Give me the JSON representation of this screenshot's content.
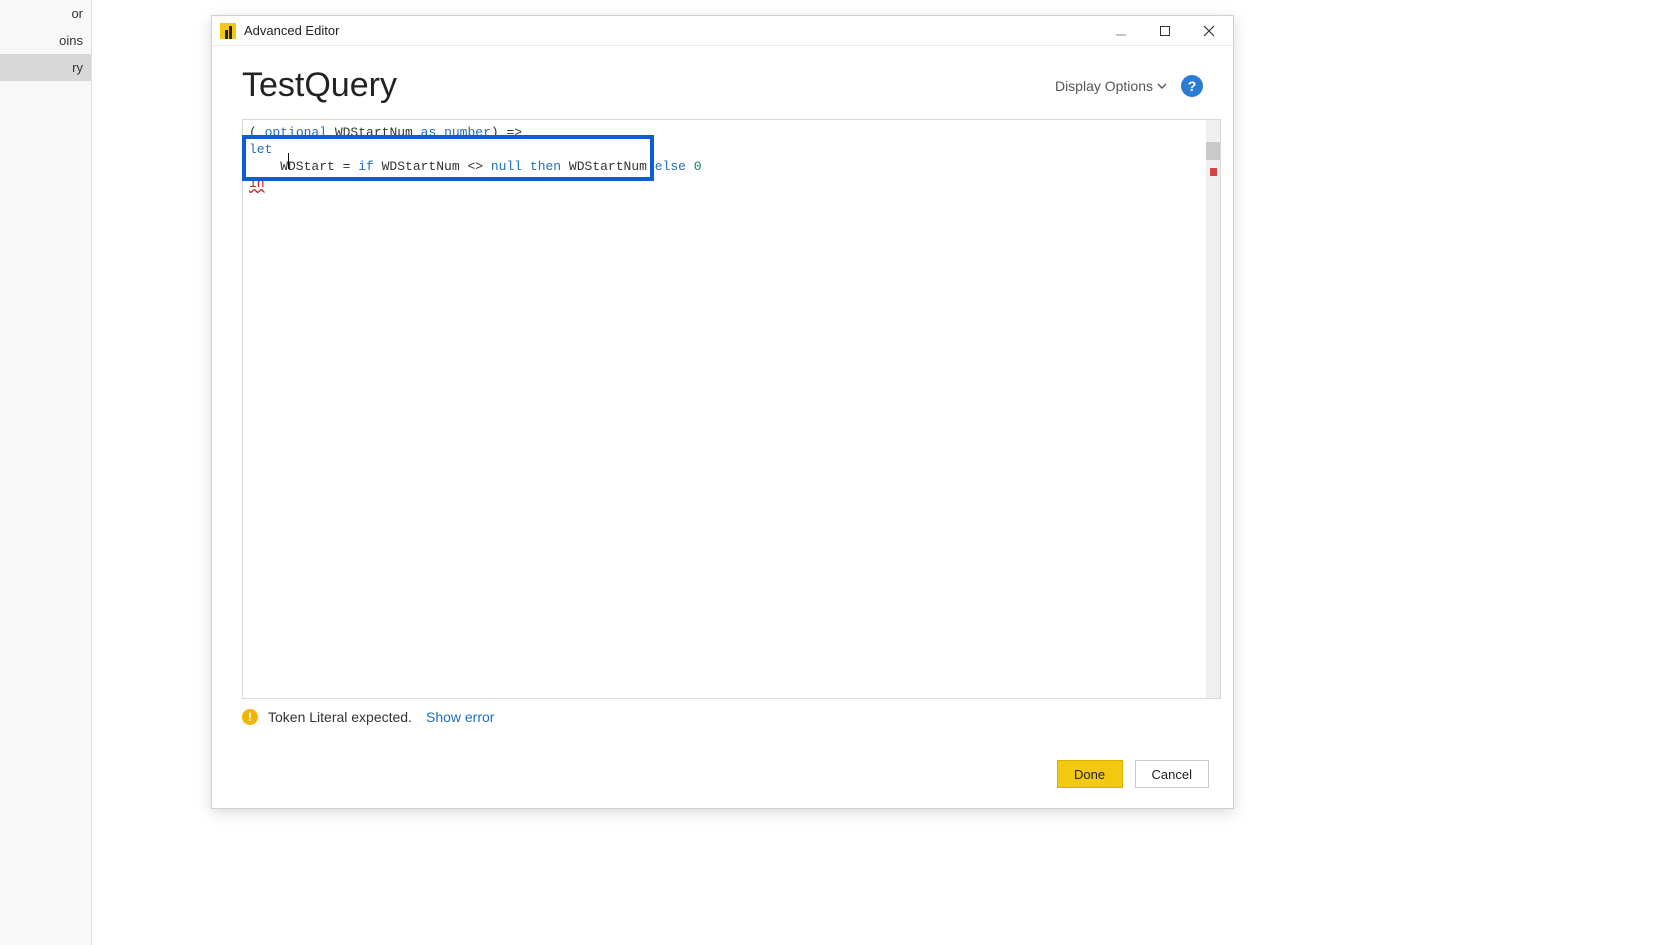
{
  "sidebar": {
    "items": [
      {
        "label": "or"
      },
      {
        "label": "oins"
      },
      {
        "label": "ry"
      }
    ],
    "selected_index": 2
  },
  "window": {
    "title": "Advanced Editor"
  },
  "query": {
    "name": "TestQuery"
  },
  "options": {
    "display_label": "Display Options"
  },
  "code": {
    "line1_open": "( ",
    "line1_kw1": "optional",
    "line1_ident": " WDStartNum ",
    "line1_kw2": "as",
    "line1_sp": " ",
    "line1_type": "number",
    "line1_close": ") =>",
    "line2_kw": "let",
    "line3_indent": "    WDStart = ",
    "line3_if": "if",
    "line3_mid1": " WDStartNum <> ",
    "line3_null": "null",
    "line3_sp1": " ",
    "line3_then": "then",
    "line3_mid2": " WDStartNum ",
    "line3_else": "else",
    "line3_sp2": " ",
    "line3_val": "0",
    "line4_err": "in"
  },
  "status": {
    "message": "Token Literal expected.",
    "show_error": "Show error"
  },
  "buttons": {
    "done": "Done",
    "cancel": "Cancel"
  }
}
